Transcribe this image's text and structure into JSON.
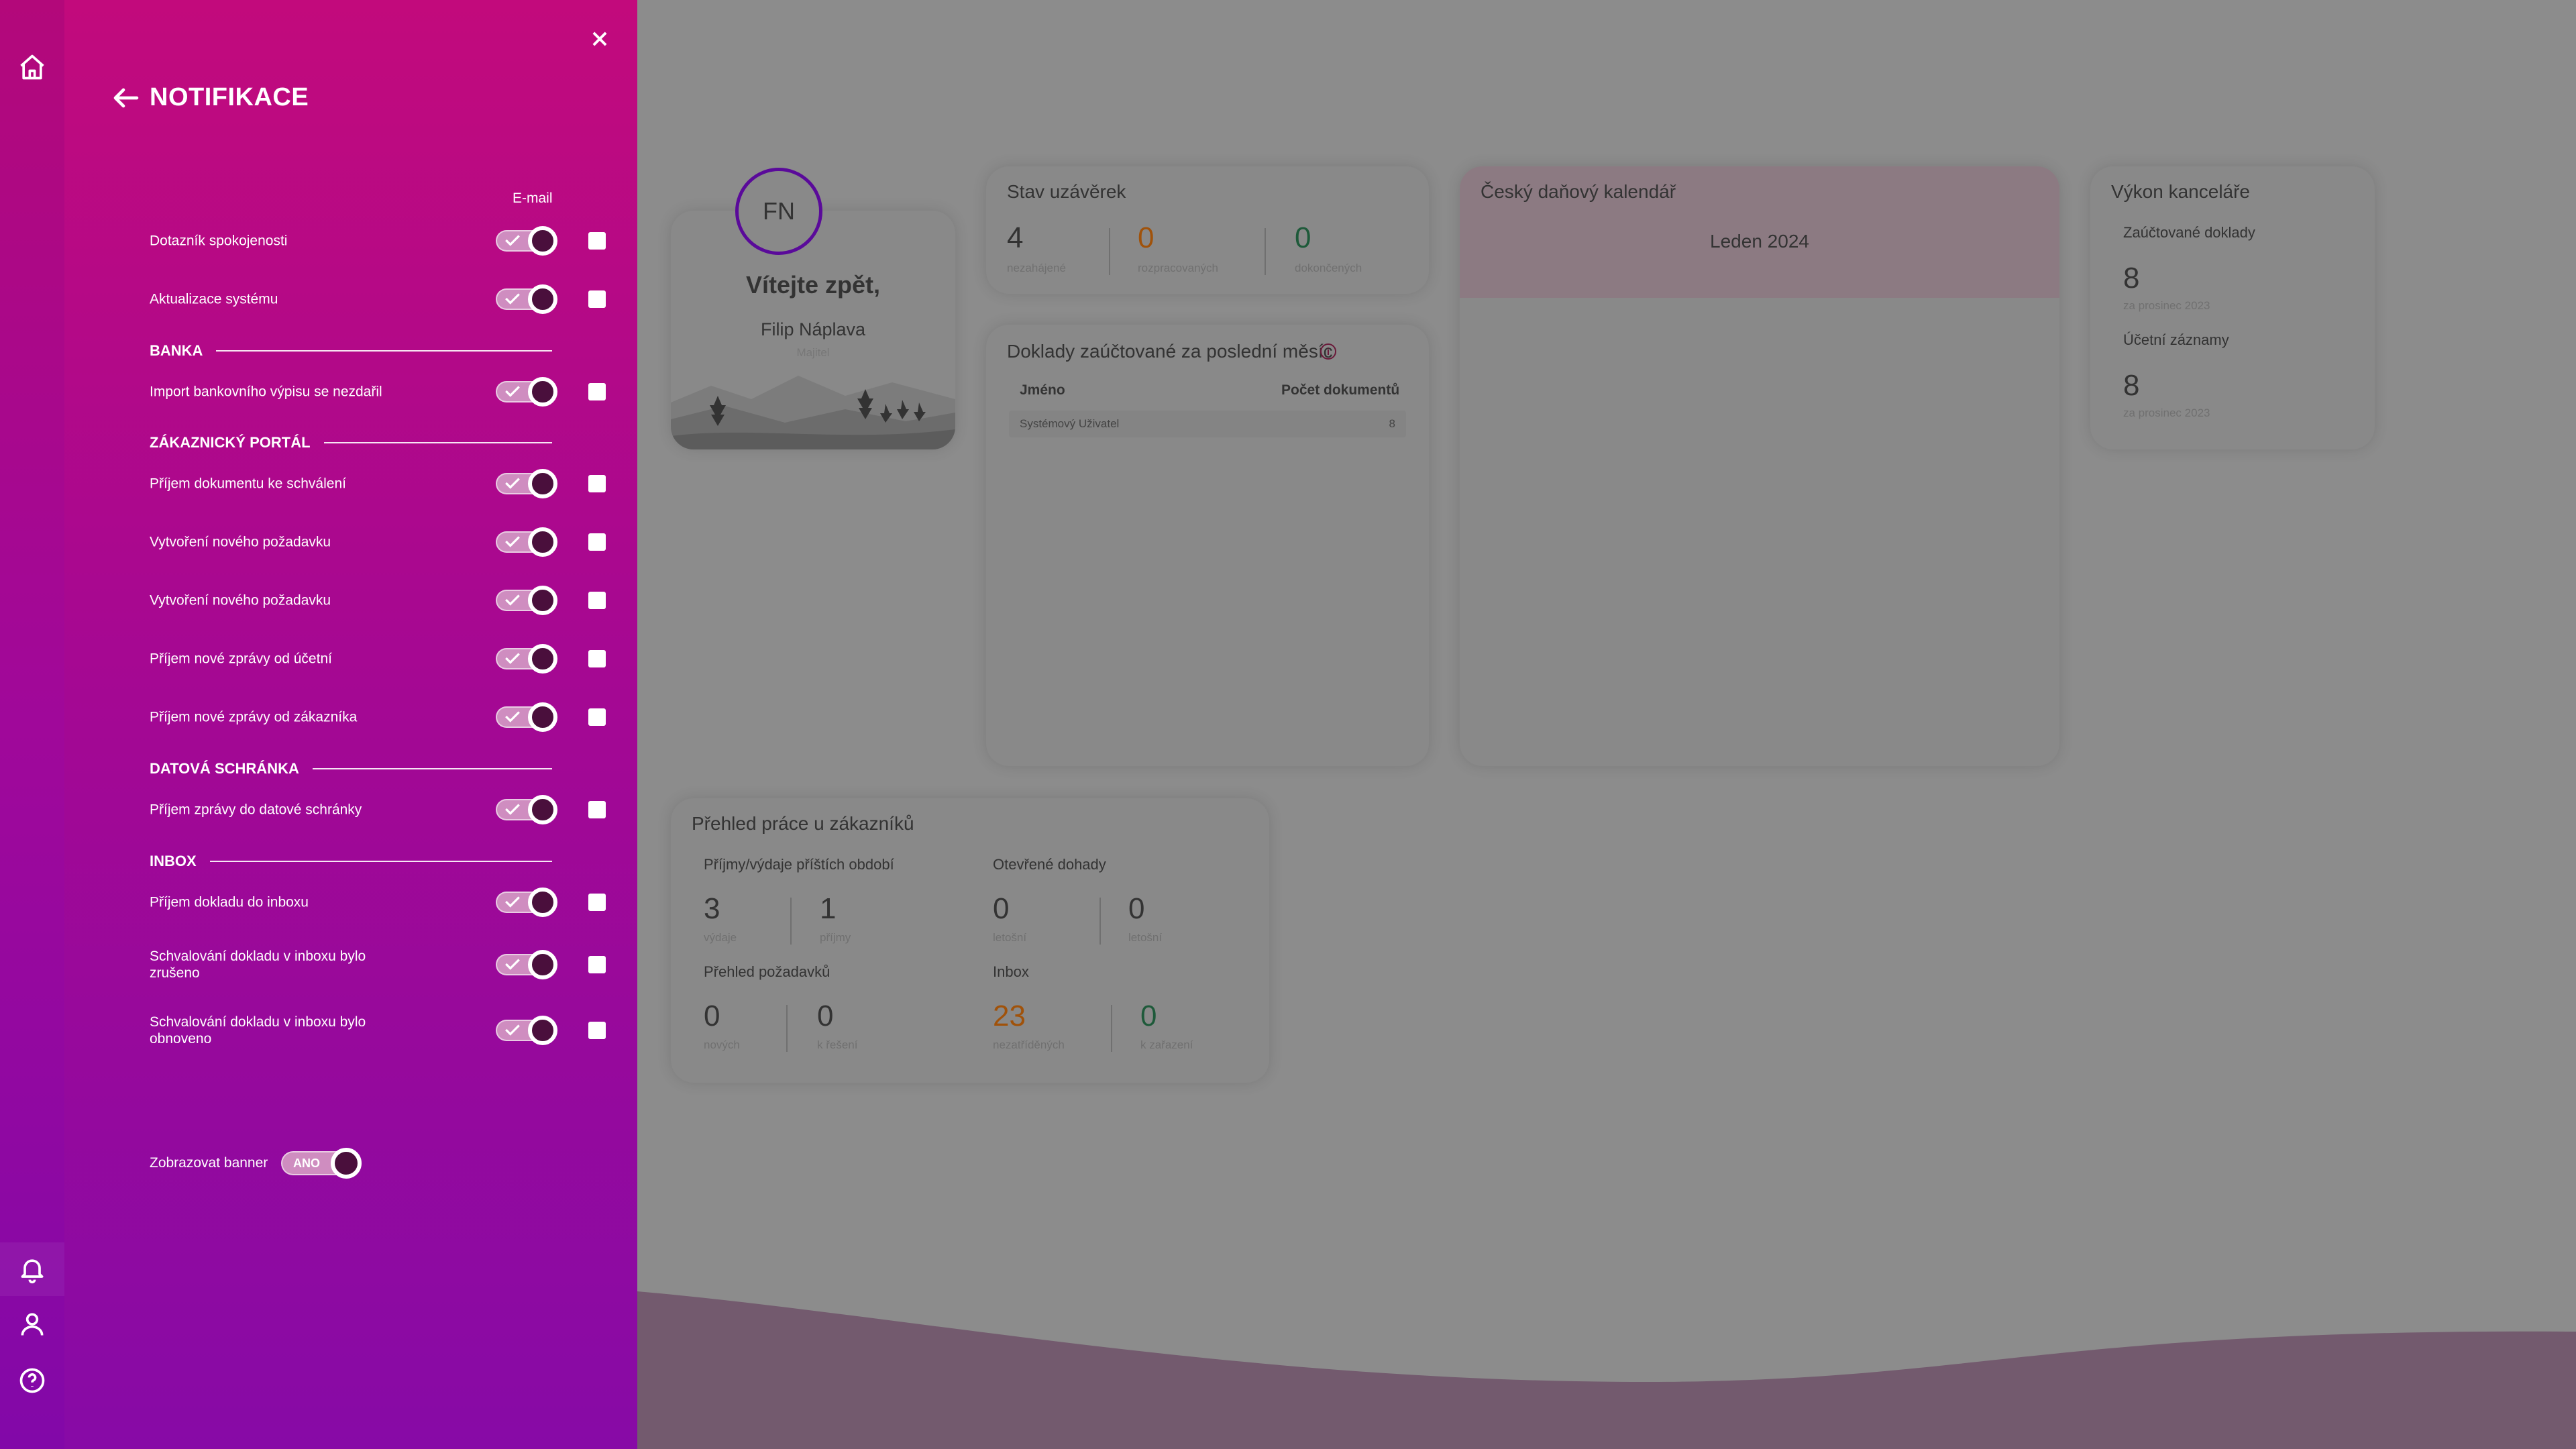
{
  "panel": {
    "title": "NOTIFIKACE",
    "email_header": "E-mail",
    "rows": [
      {
        "label": "Dotazník spokojenosti",
        "app_enabled": true,
        "email_enabled": false
      },
      {
        "label": "Aktualizace systému",
        "app_enabled": true,
        "email_enabled": false
      },
      {
        "label": "Import bankovního výpisu se nezdařil",
        "app_enabled": true,
        "email_enabled": false
      },
      {
        "label": "Příjem dokumentu ke schválení",
        "app_enabled": true,
        "email_enabled": false
      },
      {
        "label": "Vytvoření nového požadavku",
        "app_enabled": true,
        "email_enabled": false
      },
      {
        "label": "Vytvoření nového požadavku",
        "app_enabled": true,
        "email_enabled": false
      },
      {
        "label": "Příjem nové zprávy od účetní",
        "app_enabled": true,
        "email_enabled": false
      },
      {
        "label": "Příjem nové zprávy od zákazníka",
        "app_enabled": true,
        "email_enabled": false
      },
      {
        "label": "Příjem zprávy do datové schránky",
        "app_enabled": true,
        "email_enabled": false
      },
      {
        "label": "Příjem dokladu do inboxu",
        "app_enabled": true,
        "email_enabled": false
      },
      {
        "label": "Schvalování dokladu v inboxu bylo zrušeno",
        "app_enabled": true,
        "email_enabled": false
      },
      {
        "label": "Schvalování dokladu v inboxu bylo obnoveno",
        "app_enabled": true,
        "email_enabled": false
      }
    ],
    "sections": [
      "BANKA",
      "ZÁKAZNICKÝ PORTÁL",
      "DATOVÁ SCHRÁNKA",
      "INBOX"
    ],
    "banner": {
      "label": "Zobrazovat banner",
      "toggle_text": "ANO",
      "enabled": true
    }
  },
  "rail": {
    "icons": [
      "home-icon",
      "bell-icon",
      "user-icon",
      "help-icon"
    ]
  },
  "dashboard": {
    "welcome": {
      "initials": "FN",
      "greeting": "Vítejte zpět,",
      "name": "Filip Náplava",
      "role": "Majitel"
    },
    "closings": {
      "title": "Stav uzávěrek",
      "stats": [
        {
          "value": "4",
          "label": "nezahájené",
          "color": "#333333"
        },
        {
          "value": "0",
          "label": "rozpracovaných",
          "color": "#a0520a"
        },
        {
          "value": "0",
          "label": "dokončených",
          "color": "#1e5a3a"
        }
      ]
    },
    "documents": {
      "title": "Doklady zaúčtované za poslední měsíc",
      "col_name": "Jméno",
      "col_count": "Počet dokumentů",
      "rows": [
        {
          "name": "Systémový Uživatel",
          "count": "8"
        }
      ]
    },
    "calendar": {
      "title": "Český daňový kalendář",
      "month": "Leden 2024"
    },
    "office": {
      "title": "Výkon kanceláře",
      "blocks": [
        {
          "label": "Zaúčtované doklady",
          "value": "8",
          "sub": "za prosinec 2023"
        },
        {
          "label": "Účetní záznamy",
          "value": "8",
          "sub": "za prosinec 2023"
        }
      ]
    },
    "overview": {
      "title": "Přehled práce u zákazníků",
      "groups": [
        {
          "label": "Příjmy/výdaje příštích období",
          "stats": [
            {
              "value": "3",
              "label": "výdaje",
              "color": "#333333"
            },
            {
              "value": "1",
              "label": "příjmy",
              "color": "#333333"
            }
          ]
        },
        {
          "label": "Otevřené dohady",
          "stats": [
            {
              "value": "0",
              "label": "letošní",
              "color": "#333333"
            },
            {
              "value": "0",
              "label": "letošní",
              "color": "#333333"
            }
          ]
        },
        {
          "label": "Přehled požadavků",
          "stats": [
            {
              "value": "0",
              "label": "nových",
              "color": "#333333"
            },
            {
              "value": "0",
              "label": "k řešení",
              "color": "#333333"
            }
          ]
        },
        {
          "label": "Inbox",
          "stats": [
            {
              "value": "23",
              "label": "nezatříděných",
              "color": "#a0520a"
            },
            {
              "value": "0",
              "label": "k zařazení",
              "color": "#1e5a3a"
            }
          ]
        }
      ]
    }
  }
}
